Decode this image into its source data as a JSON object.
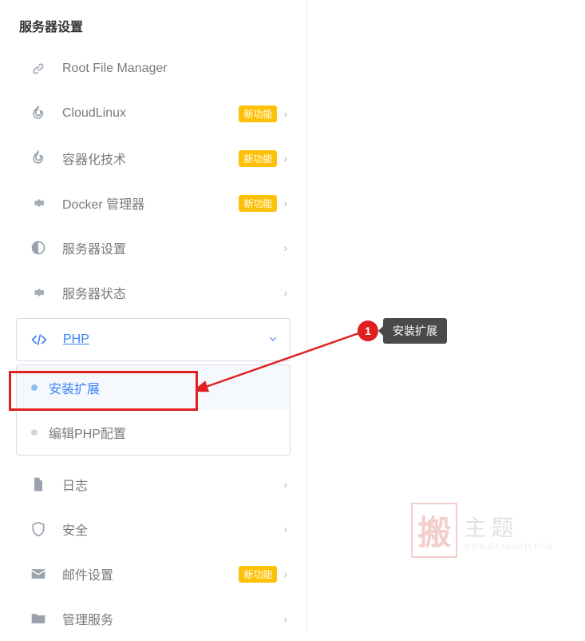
{
  "sidebar": {
    "title": "服务器设置",
    "items": [
      {
        "icon": "link",
        "label": "Root File Manager",
        "badge": null,
        "chevron": false
      },
      {
        "icon": "flame",
        "label": "CloudLinux",
        "badge": "新功能",
        "chevron": true
      },
      {
        "icon": "flame",
        "label": "容器化技术",
        "badge": "新功能",
        "chevron": true
      },
      {
        "icon": "gear",
        "label": "Docker 管理器",
        "badge": "新功能",
        "chevron": true
      },
      {
        "icon": "contrast",
        "label": "服务器设置",
        "badge": null,
        "chevron": true
      },
      {
        "icon": "gear",
        "label": "服务器状态",
        "badge": null,
        "chevron": true
      },
      {
        "icon": "code",
        "label": "PHP",
        "badge": null,
        "chevron": "down",
        "expanded": true
      },
      {
        "icon": "file",
        "label": "日志",
        "badge": null,
        "chevron": true
      },
      {
        "icon": "shield",
        "label": "安全",
        "badge": null,
        "chevron": true
      },
      {
        "icon": "mail",
        "label": "邮件设置",
        "badge": "新功能",
        "chevron": true
      },
      {
        "icon": "folder",
        "label": "管理服务",
        "badge": null,
        "chevron": true
      }
    ],
    "submenu_php": [
      {
        "label": "安装扩展",
        "active": true
      },
      {
        "label": "编辑PHP配置",
        "active": false
      }
    ]
  },
  "callout": {
    "number": "1",
    "label": "安装扩展"
  },
  "watermark": {
    "block": "搬",
    "main": "主题",
    "url": "WWW.BANZHUTI.COM"
  }
}
